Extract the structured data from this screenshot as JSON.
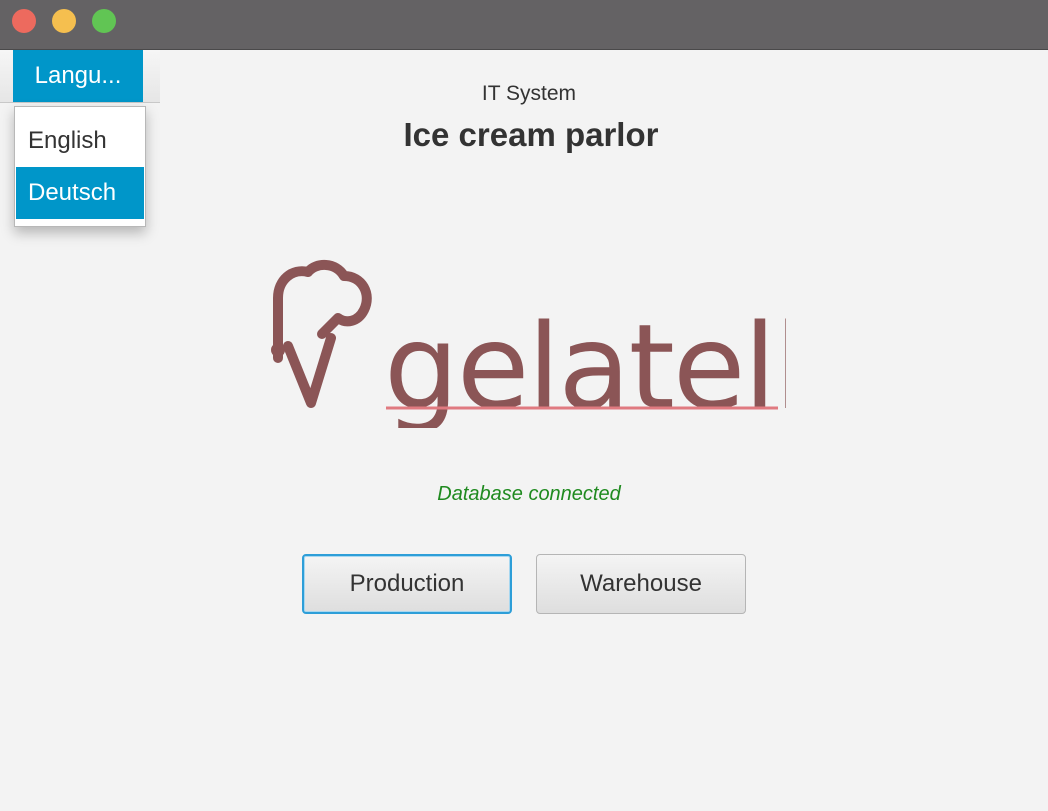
{
  "window": {
    "controls": [
      "close",
      "minimize",
      "maximize"
    ],
    "colors": {
      "close": "#ed6a5e",
      "minimize": "#f5bf4f",
      "maximize": "#61c554",
      "titlebar": "#646264"
    }
  },
  "menu": {
    "language_label": "Langu...",
    "items": [
      {
        "label": "English",
        "selected": false
      },
      {
        "label": "Deutsch",
        "selected": true
      }
    ],
    "accent_color": "#0096c9"
  },
  "header": {
    "subtitle": "IT System",
    "title": "Ice cream parlor"
  },
  "logo": {
    "wordmark": "gelatelli",
    "icon": "ice-cream-cone-icon",
    "color": "#8b5556"
  },
  "status": {
    "text": "Database connected",
    "color": "#1f8a1f"
  },
  "buttons": {
    "production": "Production",
    "warehouse": "Warehouse"
  }
}
